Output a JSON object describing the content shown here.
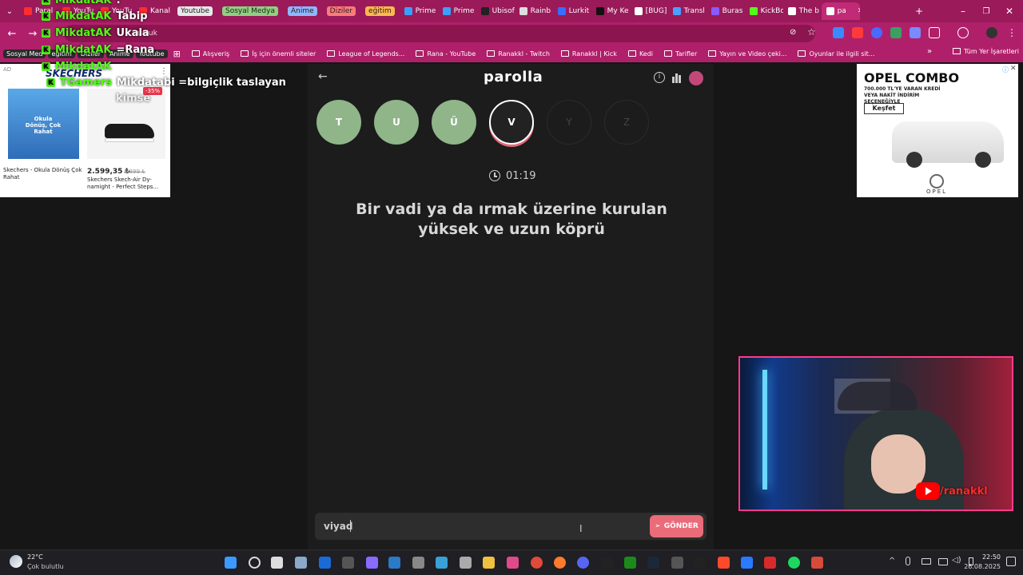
{
  "tabs": [
    {
      "label": "Paral",
      "fav": "#ff2d2d"
    },
    {
      "label": "YouTu",
      "fav": "#ff2d2d"
    },
    {
      "label": "YouTu",
      "fav": "#ff2d2d"
    },
    {
      "label": "Kanal",
      "fav": "#ff2d2d"
    },
    {
      "label": "Youtube",
      "pill": "#e8e8e8",
      "pillText": "#222"
    },
    {
      "label": "Sosyal Medya",
      "pill": "#8fd17f",
      "pillText": "#222"
    },
    {
      "label": "Anime",
      "pill": "#8fb6ff",
      "pillText": "#222"
    },
    {
      "label": "Diziler",
      "pill": "#ff7a7a",
      "pillText": "#222"
    },
    {
      "label": "eğitim",
      "pill": "#ffb84d",
      "pillText": "#222"
    },
    {
      "label": "Prime",
      "fav": "#3aa0ff"
    },
    {
      "label": "Prime",
      "fav": "#3aa0ff"
    },
    {
      "label": "Ubisof",
      "fav": "#222"
    },
    {
      "label": "Rainb",
      "fav": "#ddd"
    },
    {
      "label": "Lurkit",
      "fav": "#3a6cff"
    },
    {
      "label": "My Ke",
      "fav": "#111"
    },
    {
      "label": "[BUG]",
      "fav": "#fff"
    },
    {
      "label": "Transl",
      "fav": "#4aa0ff"
    },
    {
      "label": "Buras",
      "fav": "#8a5aff"
    },
    {
      "label": "KickBo",
      "fav": "#53fc18"
    },
    {
      "label": "The b",
      "fav": "#fff"
    },
    {
      "label": "pa",
      "fav": "#fff",
      "active": true
    }
  ],
  "window_controls": {
    "new_tab": "+",
    "minimize": "–",
    "maximize": "❐",
    "close": "✕"
  },
  "address": {
    "url": "unluk"
  },
  "bookmarks": {
    "pills": [
      "Sosyal Med",
      "eğitim",
      "Diziler",
      "Anime",
      "Youtube"
    ],
    "items": [
      "Alışveriş",
      "İş için önemli siteler",
      "League of Legends...",
      "Rana - YouTube",
      "Ranakkl - Twitch",
      "Ranakkl | Kick",
      "Kedi",
      "Tarifler",
      "Yayın ve Video çeki...",
      "Oyunlar ile ilgili sit..."
    ],
    "more": "»",
    "all": "Tüm Yer İşaretleri"
  },
  "chat": [
    {
      "user": "MikdatAK",
      "msg": ":"
    },
    {
      "user": "MikdatAK",
      "msg": "Tabip"
    },
    {
      "user": "MikdatAK",
      "msg": "Ukala"
    },
    {
      "user": "MikdatAK",
      "msg": "=Rana"
    },
    {
      "user": "MikdatAK",
      "msg": ""
    },
    {
      "user": "TGamers",
      "msg": "Mikdatabi =bilgiçlik taslayan"
    },
    {
      "user": "",
      "msg": "kimse"
    }
  ],
  "left_ad": {
    "tag": "AD",
    "brand": "SKECHERS",
    "banner_text": "Okula Dönüş, Çok Rahat",
    "item1_caption": "Skechers - Okula Dönüş Çok Rahat",
    "discount": "-35%",
    "price": "2.599,35 ₺",
    "old_price": "3.999 ₺",
    "item2_caption": "Skechers Skech-Air Dy-namight - Perfect Steps..."
  },
  "right_ad": {
    "title": "OPEL COMBO",
    "subtitle": "700.000 TL'YE VARAN KREDİ VEYA NAKİT İNDİRİM SEÇENEĞİYLE",
    "cta": "Keşfet",
    "brand": "OPEL"
  },
  "game": {
    "logo": "parolla",
    "letters": [
      {
        "letter": "T",
        "state": "done"
      },
      {
        "letter": "U",
        "state": "done"
      },
      {
        "letter": "Ü",
        "state": "done"
      },
      {
        "letter": "V",
        "state": "current"
      },
      {
        "letter": "Y",
        "state": "pending"
      },
      {
        "letter": "Z",
        "state": "pending"
      }
    ],
    "timer": "01:19",
    "question_line1": "Bir vadi ya da ırmak üzerine kurulan",
    "question_line2": "yüksek ve uzun köprü",
    "answer": "viyad",
    "send_label": "GÖNDER"
  },
  "webcam": {
    "channel": "/ranakkl"
  },
  "taskbar": {
    "weather_temp": "22°C",
    "weather_desc": "Çok bulutlu",
    "time": "22:50",
    "date": "26.08.2025"
  },
  "colors": {
    "browser_accent": "#b0206a",
    "kick_green": "#53fc18",
    "done_green": "#8fb589",
    "send_pink": "#ea6b79"
  }
}
